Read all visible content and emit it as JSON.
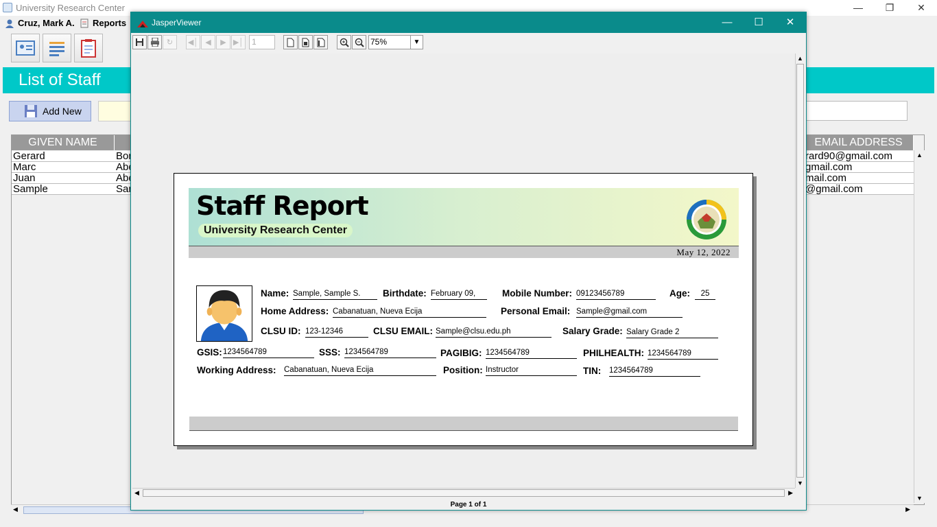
{
  "main_window": {
    "title": "University Research Center",
    "menu": {
      "user": "Cruz, Mark A.",
      "reports": "Reports"
    },
    "banner_title": "List of Staff",
    "add_new_label": "Add New",
    "table": {
      "columns": [
        "GIVEN NAME",
        "EMAIL ADDRESS"
      ],
      "rows": [
        {
          "given": "Gerard",
          "middle": "Bor",
          "email": "rard90@gmail.com"
        },
        {
          "given": "Marc",
          "middle": "Abe",
          "email": "gmail.com"
        },
        {
          "given": "Juan",
          "middle": "Abe",
          "email": "mail.com"
        },
        {
          "given": "Sample",
          "middle": "San",
          "email": "@gmail.com"
        }
      ]
    }
  },
  "viewer": {
    "title": "JasperViewer",
    "page_number": "1",
    "zoom": "75%",
    "status": "Page 1 of 1"
  },
  "report": {
    "title": "Staff Report",
    "subtitle": "University Research Center",
    "date": "May 12, 2022",
    "fields": {
      "name_label": "Name:",
      "name": "Sample, Sample S.",
      "birthdate_label": "Birthdate:",
      "birthdate": "February 09,",
      "mobile_label": "Mobile Number:",
      "mobile": "09123456789",
      "age_label": "Age:",
      "age": "25",
      "home_label": "Home Address:",
      "home": "Cabanatuan, Nueva Ecija",
      "email_label": "Personal Email:",
      "email": "Sample@gmail.com",
      "clsuid_label": "CLSU ID:",
      "clsuid": "123-12346",
      "clsuemail_label": "CLSU EMAIL:",
      "clsuemail": "Sample@clsu.edu.ph",
      "salary_label": "Salary Grade:",
      "salary": "Salary Grade 2",
      "gsis_label": "GSIS:",
      "gsis": "1234564789",
      "sss_label": "SSS:",
      "sss": "1234564789",
      "pagibig_label": "PAGIBIG:",
      "pagibig": "1234564789",
      "philhealth_label": "PHILHEALTH:",
      "philhealth": "1234564789",
      "work_label": "Working Address:",
      "work": "Cabanatuan, Nueva Ecija",
      "position_label": "Position:",
      "position": "Instructor",
      "tin_label": "TIN:",
      "tin": "1234564789"
    }
  },
  "colors": {
    "teal_banner": "#00c8c8",
    "viewer_title": "#0a8b8b"
  }
}
